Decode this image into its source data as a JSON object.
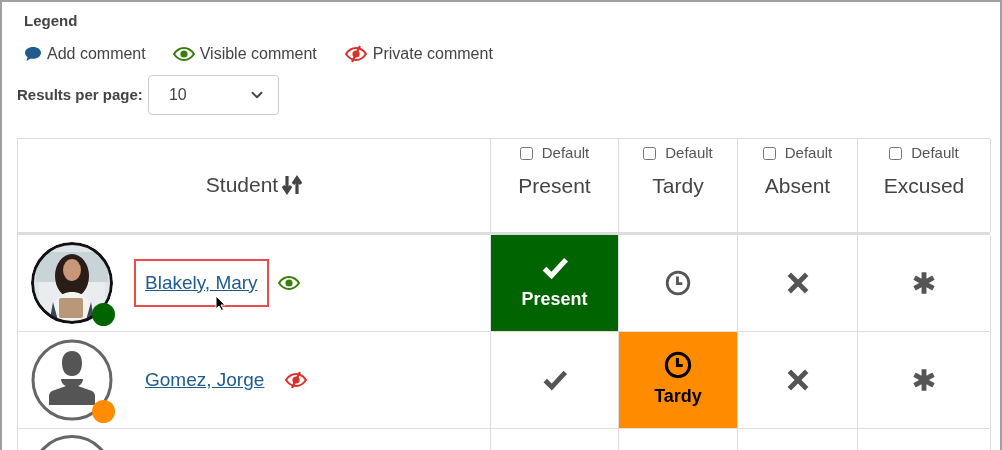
{
  "legend": {
    "title": "Legend",
    "items": [
      {
        "kind": "add",
        "label": "Add comment"
      },
      {
        "kind": "visible",
        "label": "Visible comment"
      },
      {
        "kind": "private",
        "label": "Private comment"
      }
    ]
  },
  "results_per_page": {
    "label": "Results per page:",
    "value": "10"
  },
  "table": {
    "student_header": "Student",
    "columns": [
      {
        "kind": "present",
        "default_label": "Default",
        "checked": false,
        "label": "Present"
      },
      {
        "kind": "tardy",
        "default_label": "Default",
        "checked": false,
        "label": "Tardy"
      },
      {
        "kind": "absent",
        "default_label": "Default",
        "checked": false,
        "label": "Absent"
      },
      {
        "kind": "excused",
        "default_label": "Default",
        "checked": false,
        "label": "Excused"
      }
    ],
    "rows": [
      {
        "name": "Blakely, Mary",
        "color": "#006400",
        "comment": {
          "kind": "visible"
        },
        "highlighted": true,
        "cells": [
          {
            "selected": true,
            "label": "Present"
          },
          {
            "selected": false
          },
          {
            "selected": false
          },
          {
            "selected": false
          }
        ]
      },
      {
        "name": "Gomez, Jorge",
        "avatar": {
          "kind": "silhouette"
        },
        "color": "#ff8c00",
        "comment": {
          "kind": "private"
        },
        "highlighted": false,
        "cells": [
          {
            "selected": false
          },
          {
            "selected": true,
            "label": "Tardy"
          },
          {
            "selected": false
          },
          {
            "selected": false
          }
        ]
      }
    ]
  }
}
